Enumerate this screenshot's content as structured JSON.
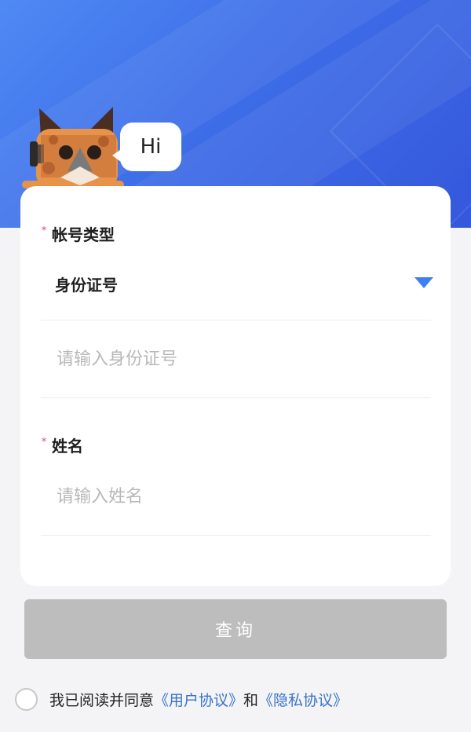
{
  "mascot": {
    "greeting": "Hi"
  },
  "form": {
    "account_type_label": "帐号类型",
    "account_type_value": "身份证号",
    "id_input_placeholder": "请输入身份证号",
    "name_label": "姓名",
    "name_input_placeholder": "请输入姓名",
    "required_mark": "*"
  },
  "actions": {
    "query_label": "查询"
  },
  "agreement": {
    "prefix": "我已阅读并同意",
    "user_agreement": "《用户协议》",
    "conjunction": "和",
    "privacy_agreement": "《隐私协议》"
  },
  "colors": {
    "header_blue": "#3e6ee8",
    "dropdown_arrow": "#3f7ff0",
    "required_mark": "#e2457e",
    "link": "#3a73c8",
    "disabled_button": "#bdbdbd"
  },
  "icons": {
    "dropdown": "triangle-down-icon",
    "mascot": "cat-mascot-icon",
    "checkbox": "radio-circle-icon"
  }
}
